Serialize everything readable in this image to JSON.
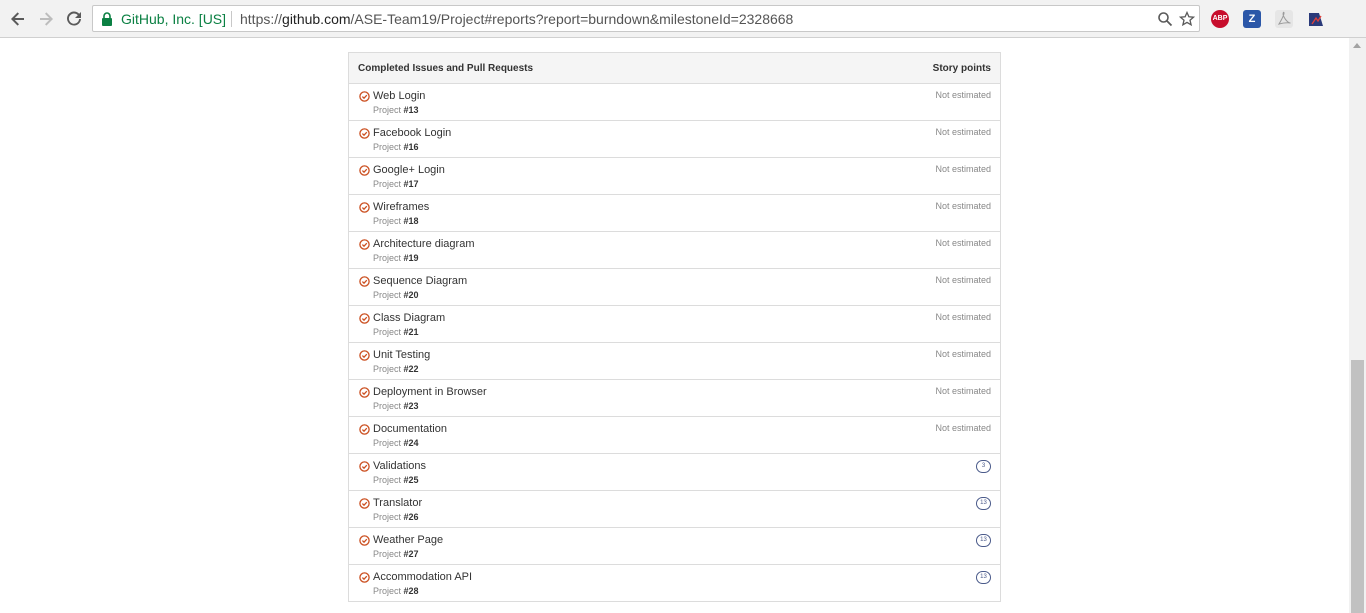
{
  "browser": {
    "site_name": "GitHub, Inc. [US]",
    "url_prefix": "https://",
    "url_host": "github.com",
    "url_path": "/ASE-Team19/Project#reports?report=burndown&milestoneId=2328668",
    "extensions": [
      {
        "name": "adblock-plus-icon",
        "label": "ABP",
        "color": "#c70d2c"
      },
      {
        "name": "zotero-icon",
        "label": "Z",
        "color": "#2b57a8"
      },
      {
        "name": "pdf-icon",
        "label": "",
        "color": "#bbbbbb"
      },
      {
        "name": "extension-icon",
        "label": "",
        "color": "#2a3a7a"
      }
    ]
  },
  "table": {
    "header_left": "Completed Issues and Pull Requests",
    "header_right": "Story points",
    "icon_color": "#cb4f20",
    "rows": [
      {
        "title": "Web Login",
        "repo": "Project",
        "number": "#13",
        "estimate": "Not estimated"
      },
      {
        "title": "Facebook Login",
        "repo": "Project",
        "number": "#16",
        "estimate": "Not estimated"
      },
      {
        "title": "Google+ Login",
        "repo": "Project",
        "number": "#17",
        "estimate": "Not estimated"
      },
      {
        "title": "Wireframes",
        "repo": "Project",
        "number": "#18",
        "estimate": "Not estimated"
      },
      {
        "title": "Architecture diagram",
        "repo": "Project",
        "number": "#19",
        "estimate": "Not estimated"
      },
      {
        "title": "Sequence Diagram",
        "repo": "Project",
        "number": "#20",
        "estimate": "Not estimated"
      },
      {
        "title": "Class Diagram",
        "repo": "Project",
        "number": "#21",
        "estimate": "Not estimated"
      },
      {
        "title": "Unit Testing",
        "repo": "Project",
        "number": "#22",
        "estimate": "Not estimated"
      },
      {
        "title": "Deployment in Browser",
        "repo": "Project",
        "number": "#23",
        "estimate": "Not estimated"
      },
      {
        "title": "Documentation",
        "repo": "Project",
        "number": "#24",
        "estimate": "Not estimated"
      },
      {
        "title": "Validations",
        "repo": "Project",
        "number": "#25",
        "points": "3"
      },
      {
        "title": "Translator",
        "repo": "Project",
        "number": "#26",
        "points": "13"
      },
      {
        "title": "Weather Page",
        "repo": "Project",
        "number": "#27",
        "points": "13"
      },
      {
        "title": "Accommodation API",
        "repo": "Project",
        "number": "#28",
        "points": "13"
      }
    ]
  }
}
